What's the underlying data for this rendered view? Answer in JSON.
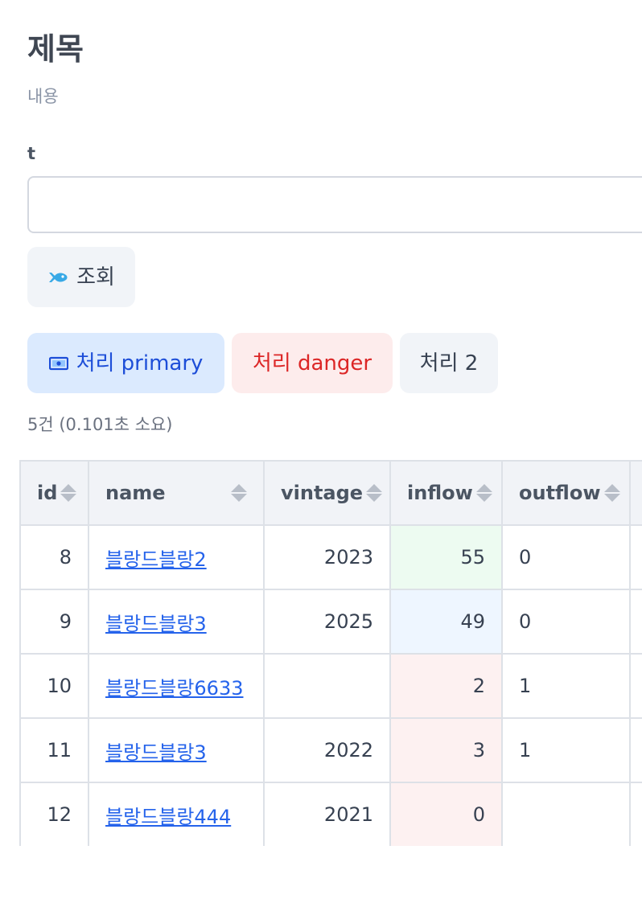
{
  "header": {
    "title": "제목",
    "subtitle": "내용"
  },
  "form": {
    "field_label": "t",
    "input_value": "",
    "input_placeholder": "",
    "search_button": {
      "label": "조회",
      "icon": "fish-icon"
    }
  },
  "actions": {
    "primary": {
      "label": "처리 primary",
      "icon": "money-icon",
      "color": "#1d4ed8"
    },
    "danger": {
      "label": "처리 danger",
      "color": "#dc2626"
    },
    "second": {
      "label": "처리 2"
    }
  },
  "result_count": "5건 (0.101초 소요)",
  "table": {
    "columns": [
      "id",
      "name",
      "vintage",
      "inflow",
      "outflow"
    ],
    "rows": [
      {
        "id": "8",
        "name": "블랑드블랑2",
        "vintage": "2023",
        "inflow": "55",
        "outflow": "0",
        "inflow_tone": "green"
      },
      {
        "id": "9",
        "name": "블랑드블랑3",
        "vintage": "2025",
        "inflow": "49",
        "outflow": "0",
        "inflow_tone": "blue"
      },
      {
        "id": "10",
        "name": "블랑드블랑6633",
        "vintage": "",
        "inflow": "2",
        "outflow": "1",
        "inflow_tone": "red"
      },
      {
        "id": "11",
        "name": "블랑드블랑3",
        "vintage": "2022",
        "inflow": "3",
        "outflow": "1",
        "inflow_tone": "red"
      },
      {
        "id": "12",
        "name": "블랑드블랑444",
        "vintage": "2021",
        "inflow": "0",
        "outflow": "",
        "inflow_tone": "red"
      }
    ]
  }
}
